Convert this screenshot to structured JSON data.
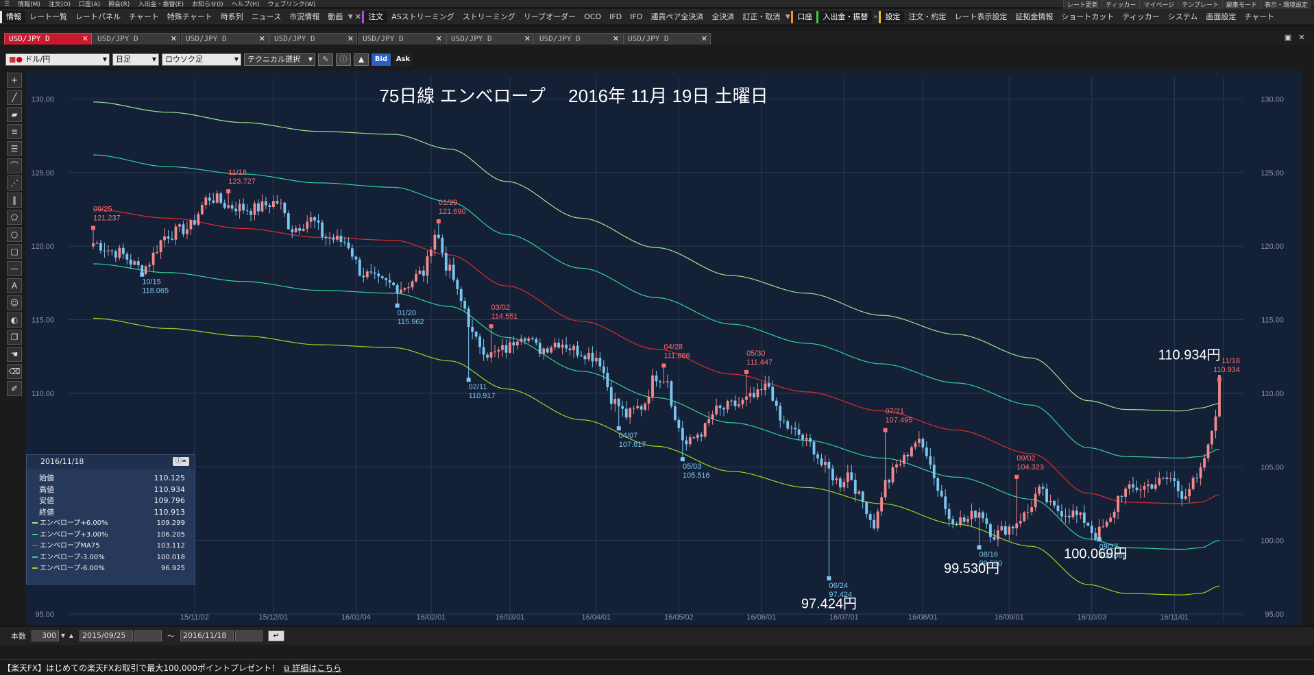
{
  "menubar": {
    "items": [
      "情報(M)",
      "注文(O)",
      "口座(A)",
      "照会(R)",
      "入出金・振替(E)",
      "お知らせ(I)",
      "ヘルプ(H)",
      "ウェブリンク(W)"
    ],
    "right_items": [
      "レート更新",
      "ティッカー",
      "マイページ",
      "テンプレート",
      "編集モード",
      "表示・環境設定"
    ]
  },
  "toolbar": {
    "info_head": "情報",
    "info_items": [
      "レート一覧",
      "レートパネル",
      "チャート",
      "特殊チャート",
      "時系列",
      "ニュース",
      "市況情報",
      "動画"
    ],
    "order_head": "注文",
    "order_items": [
      "ASストリーミング",
      "ストリーミング",
      "リーブオーダー",
      "OCO",
      "IFD",
      "IFO",
      "通貨ペア全決済",
      "全決済",
      "訂正・取消"
    ],
    "account_head": "口座",
    "deposit_head": "入出金・振替",
    "settings_head": "設定",
    "settings_items": [
      "注文・約定",
      "レート表示設定",
      "証拠金情報",
      "ショートカット",
      "ティッカー",
      "システム",
      "画面設定",
      "チャート"
    ]
  },
  "tabs": [
    "USD/JPY D",
    "USD/JPY D",
    "USD/JPY D",
    "USD/JPY D",
    "USD/JPY D",
    "USD/JPY D",
    "USD/JPY D",
    "USD/JPY D"
  ],
  "chartbar": {
    "pair": "ドル/円",
    "period": "日足",
    "style": "ロウソク足",
    "technical": "テクニカル選択",
    "bid": "Bid",
    "ask": "Ask"
  },
  "info_panel": {
    "date": "2016/11/18",
    "rows": [
      {
        "label": "始値",
        "value": "110.125"
      },
      {
        "label": "高値",
        "value": "110.934"
      },
      {
        "label": "安値",
        "value": "109.796"
      },
      {
        "label": "終値",
        "value": "110.913"
      }
    ],
    "env_rows": [
      {
        "label": "エンベロープ+6.00%",
        "value": "109.299",
        "color": "#9be88f"
      },
      {
        "label": "エンベロープ+3.00%",
        "value": "106.205",
        "color": "#2fd49b"
      },
      {
        "label": "エンベロープMA75",
        "value": "103.112",
        "color": "#e02b2b"
      },
      {
        "label": "エンベロープ-3.00%",
        "value": "100.018",
        "color": "#2fd49b"
      },
      {
        "label": "エンベロープ-6.00%",
        "value": "96.925",
        "color": "#9ed620"
      }
    ]
  },
  "bottombar": {
    "count_label": "本数",
    "count_value": "300",
    "from_date": "2015/09/25",
    "tilde": "～",
    "to_date": "2016/11/18"
  },
  "statusbar": {
    "text": "【楽天FX】はじめての楽天FXお取引で最大100,000ポイントプレゼント！",
    "link": "詳細はこちら"
  },
  "chart_data": {
    "type": "candlestick",
    "title": "75日線 エンベロープ　 2016年 11月 19日 土曜日",
    "ylim": [
      95,
      131
    ],
    "yticks": [
      "130.00",
      "125.00",
      "120.00",
      "115.00",
      "110.00",
      "105.00",
      "100.00",
      "95.00"
    ],
    "xticks": [
      {
        "label": "15/11/02",
        "i": 27
      },
      {
        "label": "15/12/01",
        "i": 48
      },
      {
        "label": "16/01/04",
        "i": 70
      },
      {
        "label": "16/02/01",
        "i": 90
      },
      {
        "label": "16/03/01",
        "i": 111
      },
      {
        "label": "16/04/01",
        "i": 134
      },
      {
        "label": "16/05/02",
        "i": 156
      },
      {
        "label": "16/06/01",
        "i": 178
      },
      {
        "label": "16/07/01",
        "i": 200
      },
      {
        "label": "16/08/01",
        "i": 221
      },
      {
        "label": "16/09/01",
        "i": 244
      },
      {
        "label": "16/10/03",
        "i": 266
      },
      {
        "label": "16/11/01",
        "i": 288
      },
      {
        "label": "",
        "i": 301
      }
    ],
    "n_bars": 301,
    "path_knots": [
      [
        0,
        120.2
      ],
      [
        6,
        119.6
      ],
      [
        13,
        118.5
      ],
      [
        20,
        120.8
      ],
      [
        25,
        121.2
      ],
      [
        31,
        123.3
      ],
      [
        37,
        122.7
      ],
      [
        42,
        122.5
      ],
      [
        49,
        123.0
      ],
      [
        53,
        121.2
      ],
      [
        58,
        121.8
      ],
      [
        62,
        120.6
      ],
      [
        67,
        120.3
      ],
      [
        72,
        118.1
      ],
      [
        77,
        117.5
      ],
      [
        82,
        117.2
      ],
      [
        88,
        118.2
      ],
      [
        91,
        120.9
      ],
      [
        95,
        118.3
      ],
      [
        98,
        116.2
      ],
      [
        102,
        113.5
      ],
      [
        106,
        112.6
      ],
      [
        110,
        113.0
      ],
      [
        114,
        114.1
      ],
      [
        119,
        113.0
      ],
      [
        124,
        113.5
      ],
      [
        129,
        112.9
      ],
      [
        134,
        112.5
      ],
      [
        139,
        109.4
      ],
      [
        142,
        108.5
      ],
      [
        146,
        109.1
      ],
      [
        150,
        111.2
      ],
      [
        153,
        111.0
      ],
      [
        155,
        108.1
      ],
      [
        158,
        106.5
      ],
      [
        162,
        107.4
      ],
      [
        166,
        108.8
      ],
      [
        171,
        109.2
      ],
      [
        176,
        109.7
      ],
      [
        180,
        110.5
      ],
      [
        183,
        108.1
      ],
      [
        187,
        107.3
      ],
      [
        191,
        106.5
      ],
      [
        195,
        104.9
      ],
      [
        199,
        103.9
      ],
      [
        201,
        104.6
      ],
      [
        205,
        102.6
      ],
      [
        208,
        101.1
      ],
      [
        211,
        103.9
      ],
      [
        215,
        105.3
      ],
      [
        219,
        106.7
      ],
      [
        222,
        106.1
      ],
      [
        225,
        103.6
      ],
      [
        228,
        101.6
      ],
      [
        232,
        101.3
      ],
      [
        236,
        102.0
      ],
      [
        240,
        100.4
      ],
      [
        244,
        100.9
      ],
      [
        248,
        101.7
      ],
      [
        252,
        103.3
      ],
      [
        256,
        102.1
      ],
      [
        260,
        101.9
      ],
      [
        264,
        101.4
      ],
      [
        267,
        100.4
      ],
      [
        270,
        101.0
      ],
      [
        274,
        103.3
      ],
      [
        279,
        103.6
      ],
      [
        283,
        103.9
      ],
      [
        287,
        104.2
      ],
      [
        290,
        103.2
      ],
      [
        294,
        104.0
      ],
      [
        297,
        106.2
      ],
      [
        299,
        108.8
      ],
      [
        300,
        110.9
      ]
    ],
    "lines": [
      {
        "name": "エンベロープ+6.00%",
        "color": "#9be88f",
        "knots": [
          [
            0,
            129.8
          ],
          [
            20,
            129.1
          ],
          [
            40,
            128.4
          ],
          [
            60,
            127.8
          ],
          [
            80,
            127.6
          ],
          [
            95,
            126.6
          ],
          [
            110,
            124.4
          ],
          [
            130,
            121.9
          ],
          [
            150,
            119.9
          ],
          [
            170,
            118.0
          ],
          [
            190,
            116.8
          ],
          [
            210,
            115.3
          ],
          [
            230,
            114.0
          ],
          [
            250,
            112.4
          ],
          [
            265,
            109.5
          ],
          [
            275,
            108.9
          ],
          [
            290,
            108.8
          ],
          [
            295,
            109.0
          ],
          [
            300,
            109.3
          ]
        ]
      },
      {
        "name": "エンベロープ+3.00%",
        "color": "#2fd49b",
        "knots": [
          [
            0,
            126.2
          ],
          [
            20,
            125.4
          ],
          [
            40,
            124.9
          ],
          [
            60,
            124.3
          ],
          [
            80,
            124.0
          ],
          [
            95,
            123.0
          ],
          [
            110,
            120.8
          ],
          [
            130,
            118.5
          ],
          [
            150,
            116.5
          ],
          [
            170,
            114.7
          ],
          [
            190,
            113.4
          ],
          [
            210,
            112.0
          ],
          [
            230,
            110.7
          ],
          [
            250,
            109.2
          ],
          [
            265,
            106.3
          ],
          [
            275,
            105.7
          ],
          [
            290,
            105.6
          ],
          [
            295,
            105.7
          ],
          [
            300,
            106.2
          ]
        ]
      },
      {
        "name": "エンベロープMA75",
        "color": "#e02b2b",
        "knots": [
          [
            0,
            122.5
          ],
          [
            20,
            121.9
          ],
          [
            40,
            121.2
          ],
          [
            60,
            120.6
          ],
          [
            80,
            120.4
          ],
          [
            95,
            119.4
          ],
          [
            110,
            117.3
          ],
          [
            130,
            114.9
          ],
          [
            150,
            113.0
          ],
          [
            170,
            111.3
          ],
          [
            190,
            110.1
          ],
          [
            210,
            108.8
          ],
          [
            230,
            107.5
          ],
          [
            250,
            105.9
          ],
          [
            265,
            103.2
          ],
          [
            275,
            102.6
          ],
          [
            290,
            102.5
          ],
          [
            295,
            102.6
          ],
          [
            300,
            103.1
          ]
        ]
      },
      {
        "name": "エンベロープ-3.00%",
        "color": "#2fd49b",
        "knots": [
          [
            0,
            118.8
          ],
          [
            20,
            118.2
          ],
          [
            40,
            117.6
          ],
          [
            60,
            117.0
          ],
          [
            80,
            116.8
          ],
          [
            95,
            115.9
          ],
          [
            110,
            113.8
          ],
          [
            130,
            111.5
          ],
          [
            150,
            109.7
          ],
          [
            170,
            108.0
          ],
          [
            190,
            106.8
          ],
          [
            210,
            105.6
          ],
          [
            230,
            104.3
          ],
          [
            250,
            102.8
          ],
          [
            265,
            100.1
          ],
          [
            275,
            99.5
          ],
          [
            290,
            99.4
          ],
          [
            295,
            99.5
          ],
          [
            300,
            100.0
          ]
        ]
      },
      {
        "name": "エンベロープ-6.00%",
        "color": "#9ed620",
        "knots": [
          [
            0,
            115.1
          ],
          [
            20,
            114.4
          ],
          [
            40,
            113.9
          ],
          [
            60,
            113.3
          ],
          [
            80,
            113.1
          ],
          [
            95,
            112.2
          ],
          [
            110,
            110.3
          ],
          [
            130,
            108.2
          ],
          [
            150,
            106.4
          ],
          [
            170,
            104.7
          ],
          [
            190,
            103.6
          ],
          [
            210,
            102.5
          ],
          [
            230,
            101.1
          ],
          [
            250,
            99.6
          ],
          [
            265,
            97.0
          ],
          [
            275,
            96.4
          ],
          [
            290,
            96.3
          ],
          [
            295,
            96.4
          ],
          [
            300,
            96.9
          ]
        ]
      }
    ],
    "peaks": [
      {
        "i": 0,
        "date": "09/25",
        "value": "121.237",
        "kind": "high"
      },
      {
        "i": 36,
        "date": "11/18",
        "value": "123.727",
        "kind": "high"
      },
      {
        "i": 92,
        "date": "01/29",
        "value": "121.690",
        "kind": "high"
      },
      {
        "i": 106,
        "date": "03/02",
        "value": "114.551",
        "kind": "high"
      },
      {
        "i": 152,
        "date": "04/28",
        "value": "111.886",
        "kind": "high"
      },
      {
        "i": 174,
        "date": "05/30",
        "value": "111.447",
        "kind": "high"
      },
      {
        "i": 211,
        "date": "07/21",
        "value": "107.495",
        "kind": "high"
      },
      {
        "i": 246,
        "date": "09/02",
        "value": "104.323",
        "kind": "high"
      },
      {
        "i": 300,
        "date": "11/18",
        "value": "110.934",
        "kind": "high"
      },
      {
        "i": 13,
        "date": "10/15",
        "value": "118.065",
        "kind": "low"
      },
      {
        "i": 81,
        "date": "01/20",
        "value": "115.962",
        "kind": "low"
      },
      {
        "i": 100,
        "date": "02/11",
        "value": "110.917",
        "kind": "low"
      },
      {
        "i": 140,
        "date": "04/07",
        "value": "107.617",
        "kind": "low"
      },
      {
        "i": 157,
        "date": "05/03",
        "value": "105.516",
        "kind": "low"
      },
      {
        "i": 196,
        "date": "06/24",
        "value": "97.424",
        "kind": "low"
      },
      {
        "i": 236,
        "date": "08/16",
        "value": "99.530",
        "kind": "low"
      },
      {
        "i": 268,
        "date": "09/27",
        "value": "100.069",
        "kind": "low"
      }
    ],
    "big_labels": [
      {
        "text": "110.934円",
        "i": 292,
        "y": 112.3
      },
      {
        "text": "97.424円",
        "i": 196,
        "y": 95.4
      },
      {
        "text": "99.530円",
        "i": 234,
        "y": 97.8
      },
      {
        "text": "100.069円",
        "i": 267,
        "y": 98.8
      }
    ]
  }
}
